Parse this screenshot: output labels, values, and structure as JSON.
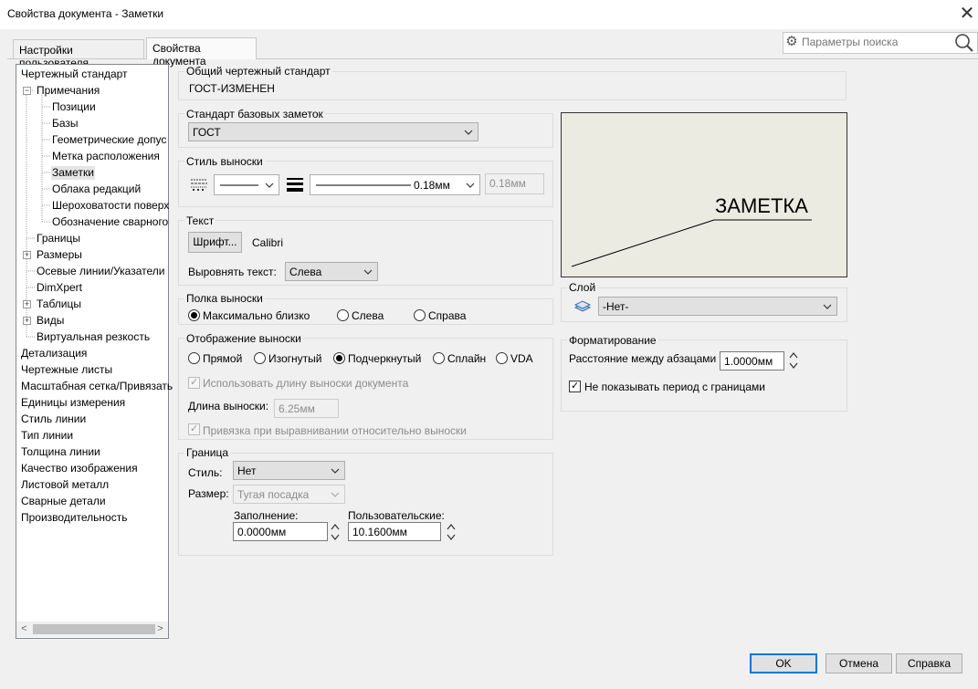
{
  "window": {
    "title": "Свойства документа - Заметки",
    "close_glyph": "✕"
  },
  "tabs": [
    "Настройки пользователя",
    "Свойства документа"
  ],
  "active_tab": 1,
  "search": {
    "placeholder": "Параметры поиска"
  },
  "tree": {
    "items": [
      "Чертежный стандарт",
      "Примечания",
      "Позиции",
      "Базы",
      "Геометрические допус",
      "Метка расположения",
      "Заметки",
      "Облака редакций",
      "Шероховатости поверх",
      "Обозначение сварного",
      "Границы",
      "Размеры",
      "Осевые линии/Указатели",
      "DimXpert",
      "Таблицы",
      "Виды",
      "Виртуальная резкость",
      "Детализация",
      "Чертежные листы",
      "Масштабная сетка/Привязать",
      "Единицы измерения",
      "Стиль линии",
      "Тип линии",
      "Толщина линии",
      "Качество изображения",
      "Листовой металл",
      "Сварные детали",
      "Производительность"
    ],
    "selected": "Заметки",
    "expand_minus": "−",
    "expand_plus": "+",
    "scroll_left": "<",
    "scroll_right": ">"
  },
  "general_standard": {
    "label": "Общий чертежный стандарт",
    "value": "ГОСТ-ИЗМЕНЕН"
  },
  "base_standard": {
    "label": "Стандарт базовых заметок",
    "value": "ГОСТ"
  },
  "leader_style": {
    "label": "Стиль выноски",
    "thickness": "0.18мм",
    "custom": "0.18мм"
  },
  "text": {
    "label": "Текст",
    "font_button": "Шрифт...",
    "font_name": "Calibri",
    "align_label": "Выровнять текст:",
    "align_value": "Слева"
  },
  "shelf": {
    "label": "Полка выноски",
    "options": [
      "Максимально близко",
      "Слева",
      "Справа"
    ],
    "selected": 0
  },
  "leader_display": {
    "label": "Отображение выноски",
    "options": [
      "Прямой",
      "Изогнутый",
      "Подчеркнутый",
      "Сплайн",
      "VDA"
    ],
    "selected": 2,
    "use_doc_length": "Использовать длину выноски документа",
    "length_label": "Длина выноски:",
    "length_value": "6.25мм",
    "snap": "Привязка при выравнивании относительно выноски"
  },
  "border": {
    "label": "Граница",
    "style_label": "Стиль:",
    "style_value": "Нет",
    "size_label": "Размер:",
    "size_value": "Тугая посадка",
    "fill_label": "Заполнение:",
    "fill_value": "0.0000мм",
    "custom_label": "Пользовательские:",
    "custom_value": "10.1600мм"
  },
  "preview": {
    "text": "ЗАМЕТКА"
  },
  "layer": {
    "label": "Слой",
    "value": "-Нет-"
  },
  "formatting": {
    "label": "Форматирование",
    "spacing_label": "Расстояние между абзацами",
    "spacing_value": "1.0000мм",
    "hide_period": "Не показывать период с границами",
    "hide_period_checked": true
  },
  "buttons": {
    "ok": "OK",
    "cancel": "Отмена",
    "help": "Справка"
  },
  "check_glyph": "✓",
  "colors": {
    "accent": "#0078d7",
    "preview_bg": "#ecebe2",
    "selected_item": "#e5e5e5"
  }
}
